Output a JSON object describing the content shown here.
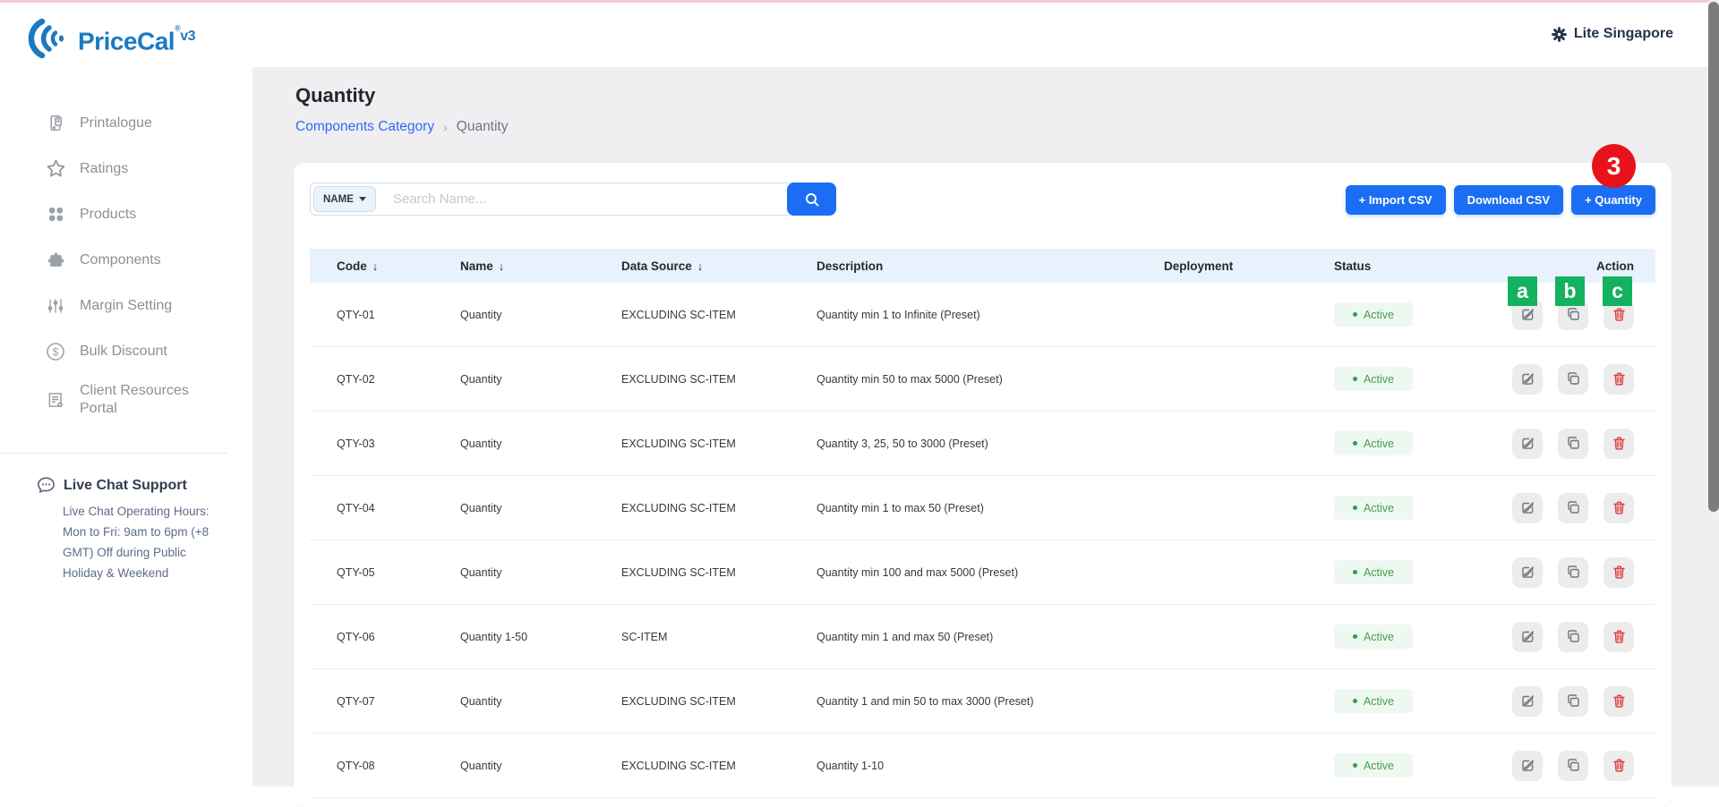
{
  "brand": {
    "name": "PriceCal",
    "reg": "®",
    "version": "v3"
  },
  "header": {
    "tenant_label": "Lite Singapore"
  },
  "sidebar": {
    "items": [
      {
        "label": "Printalogue",
        "icon": "device-icon"
      },
      {
        "label": "Ratings",
        "icon": "star-icon"
      },
      {
        "label": "Products",
        "icon": "grid-icon"
      },
      {
        "label": "Components",
        "icon": "puzzle-icon"
      },
      {
        "label": "Margin Setting",
        "icon": "sliders-icon"
      },
      {
        "label": "Bulk Discount",
        "icon": "dollar-icon"
      },
      {
        "label": "Client Resources Portal",
        "icon": "document-icon"
      }
    ],
    "support": {
      "title": "Live Chat Support",
      "text": "Live Chat Operating Hours: Mon to Fri: 9am to 6pm (+8 GMT) Off during Public Holiday & Weekend"
    }
  },
  "page": {
    "title": "Quantity",
    "breadcrumb": {
      "parent": "Components Category",
      "separator": "›",
      "current": "Quantity"
    }
  },
  "toolbar": {
    "filter_label": "NAME",
    "search_placeholder": "Search Name...",
    "search_value": "",
    "import_label": "+ Import CSV",
    "download_label": "Download CSV",
    "add_label": "+ Quantity",
    "add_badge_count": "3"
  },
  "annotations": {
    "labels": [
      "a",
      "b",
      "c"
    ]
  },
  "table": {
    "sort_icon": "↓",
    "columns": [
      {
        "label": "Code",
        "sortable": true
      },
      {
        "label": "Name",
        "sortable": true
      },
      {
        "label": "Data Source",
        "sortable": true
      },
      {
        "label": "Description",
        "sortable": false
      },
      {
        "label": "Deployment",
        "sortable": false
      },
      {
        "label": "Status",
        "sortable": false
      },
      {
        "label": "Action",
        "sortable": false
      }
    ],
    "rows": [
      {
        "code": "QTY-01",
        "name": "Quantity",
        "data_source": "EXCLUDING SC-ITEM",
        "description": "Quantity min 1 to Infinite (Preset)",
        "deployment": "",
        "status": "Active"
      },
      {
        "code": "QTY-02",
        "name": "Quantity",
        "data_source": "EXCLUDING SC-ITEM",
        "description": "Quantity min 50 to max 5000 (Preset)",
        "deployment": "",
        "status": "Active"
      },
      {
        "code": "QTY-03",
        "name": "Quantity",
        "data_source": "EXCLUDING SC-ITEM",
        "description": "Quantity 3, 25, 50 to 3000 (Preset)",
        "deployment": "",
        "status": "Active"
      },
      {
        "code": "QTY-04",
        "name": "Quantity",
        "data_source": "EXCLUDING SC-ITEM",
        "description": "Quantity min 1 to max 50 (Preset)",
        "deployment": "",
        "status": "Active"
      },
      {
        "code": "QTY-05",
        "name": "Quantity",
        "data_source": "EXCLUDING SC-ITEM",
        "description": "Quantity min 100 and max 5000 (Preset)",
        "deployment": "",
        "status": "Active"
      },
      {
        "code": "QTY-06",
        "name": "Quantity 1-50",
        "data_source": "SC-ITEM",
        "description": "Quantity min 1 and max 50 (Preset)",
        "deployment": "",
        "status": "Active"
      },
      {
        "code": "QTY-07",
        "name": "Quantity",
        "data_source": "EXCLUDING SC-ITEM",
        "description": "Quantity 1 and min 50 to max 3000 (Preset)",
        "deployment": "",
        "status": "Active"
      },
      {
        "code": "QTY-08",
        "name": "Quantity",
        "data_source": "EXCLUDING SC-ITEM",
        "description": "Quantity 1-10",
        "deployment": "",
        "status": "Active"
      }
    ]
  },
  "colors": {
    "accent_blue": "#1b6ef3",
    "logo_blue": "#1a7ac2",
    "badge_red": "#e8121b",
    "annotation_green": "#12b25f",
    "status_green": "#43a047",
    "header_band_blue": "#e8f2fc",
    "main_background": "#f0eef1",
    "topline_pink": "#f2cbd2"
  }
}
